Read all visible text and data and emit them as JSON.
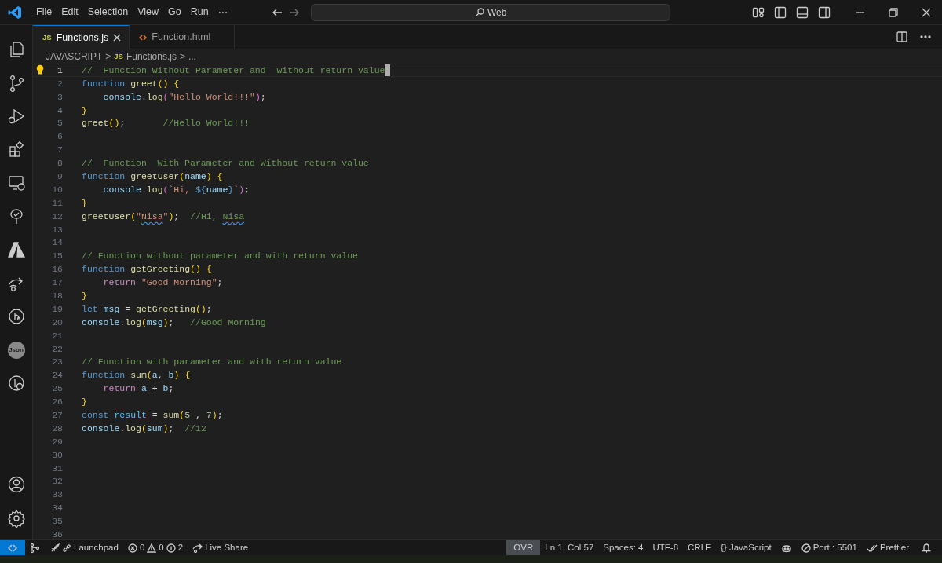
{
  "menu": [
    "File",
    "Edit",
    "Selection",
    "View",
    "Go",
    "Run",
    "···"
  ],
  "search": {
    "value": "Web"
  },
  "activity_bar": {
    "top": [
      {
        "kind": "files"
      },
      {
        "kind": "branch"
      },
      {
        "kind": "debug"
      },
      {
        "kind": "extensions"
      },
      {
        "kind": "remote"
      },
      {
        "kind": "tree"
      },
      {
        "kind": "azure"
      },
      {
        "kind": "share"
      },
      {
        "kind": "gitlens"
      },
      {
        "kind": "json",
        "text": "Json"
      },
      {
        "kind": "inspect"
      }
    ],
    "bottom": [
      {
        "kind": "account"
      },
      {
        "kind": "settings"
      }
    ]
  },
  "tabs": [
    {
      "icon_text": "JS",
      "kind": "js",
      "label": "Functions.js",
      "selected": true
    },
    {
      "kind": "html",
      "label": "Function.html",
      "selected": false
    }
  ],
  "breadcrumb": {
    "folder": "JAVASCRIPT",
    "sep": ">",
    "icon_text": "JS",
    "file": "Functions.js",
    "more": "..."
  },
  "lines": [
    {
      "number": "1",
      "current": true,
      "tokens": [
        {
          "kind": "comment",
          "text": "//  Function Without Parameter and  without return value"
        }
      ]
    },
    {
      "number": "2",
      "current": false,
      "tokens": [
        {
          "kind": "keyword",
          "text": "function "
        },
        {
          "kind": "func",
          "text": "greet"
        },
        {
          "kind": "bracket",
          "text": "() {"
        }
      ]
    },
    {
      "number": "3",
      "current": false,
      "tokens": [
        {
          "kind": "var",
          "text": "    console"
        },
        {
          "kind": "plain",
          "text": "."
        },
        {
          "kind": "func",
          "text": "log"
        },
        {
          "kind": "bracket2",
          "text": "("
        },
        {
          "kind": "string",
          "text": "\"Hello World!!!\""
        },
        {
          "kind": "bracket2",
          "text": ")"
        },
        {
          "kind": "plain",
          "text": ";"
        }
      ]
    },
    {
      "number": "4",
      "current": false,
      "tokens": [
        {
          "kind": "bracket",
          "text": "}"
        }
      ]
    },
    {
      "number": "5",
      "current": false,
      "tokens": [
        {
          "kind": "func",
          "text": "greet"
        },
        {
          "kind": "bracket",
          "text": "()"
        },
        {
          "kind": "plain",
          "text": ";       "
        },
        {
          "kind": "comment",
          "text": "//Hello World!!!"
        }
      ]
    },
    {
      "number": "6",
      "current": false
    },
    {
      "number": "7",
      "current": false
    },
    {
      "number": "8",
      "current": false,
      "tokens": [
        {
          "kind": "comment",
          "text": "//  Function  With Parameter and Without return value"
        }
      ]
    },
    {
      "number": "9",
      "current": false,
      "tokens": [
        {
          "kind": "keyword",
          "text": "function "
        },
        {
          "kind": "func",
          "text": "greetUser"
        },
        {
          "kind": "bracket",
          "text": "("
        },
        {
          "kind": "var",
          "text": "name"
        },
        {
          "kind": "bracket",
          "text": ") {"
        }
      ]
    },
    {
      "number": "10",
      "current": false,
      "tokens": [
        {
          "kind": "var",
          "text": "    console"
        },
        {
          "kind": "plain",
          "text": "."
        },
        {
          "kind": "func",
          "text": "log"
        },
        {
          "kind": "bracket2",
          "text": "("
        },
        {
          "kind": "string",
          "text": "`Hi, "
        },
        {
          "kind": "keyword",
          "text": "${"
        },
        {
          "kind": "var",
          "text": "name"
        },
        {
          "kind": "keyword",
          "text": "}"
        },
        {
          "kind": "string",
          "text": "`"
        },
        {
          "kind": "bracket2",
          "text": ")"
        },
        {
          "kind": "plain",
          "text": ";"
        }
      ]
    },
    {
      "number": "11",
      "current": false,
      "tokens": [
        {
          "kind": "bracket",
          "text": "}"
        }
      ]
    },
    {
      "number": "12",
      "current": false,
      "tokens": [
        {
          "kind": "func",
          "text": "greetUser"
        },
        {
          "kind": "bracket",
          "text": "("
        },
        {
          "kind": "string",
          "text": "\""
        },
        {
          "kind": "string",
          "text": "Nisa",
          "squiggle": true
        },
        {
          "kind": "string",
          "text": "\""
        },
        {
          "kind": "bracket",
          "text": ")"
        },
        {
          "kind": "plain",
          "text": ";  "
        },
        {
          "kind": "comment",
          "text": "//Hi, "
        },
        {
          "kind": "comment",
          "text": "Nisa",
          "squiggle": true
        }
      ]
    },
    {
      "number": "13",
      "current": false
    },
    {
      "number": "14",
      "current": false
    },
    {
      "number": "15",
      "current": false,
      "tokens": [
        {
          "kind": "comment",
          "text": "// Function without parameter and with return value"
        }
      ]
    },
    {
      "number": "16",
      "current": false,
      "tokens": [
        {
          "kind": "keyword",
          "text": "function "
        },
        {
          "kind": "func",
          "text": "getGreeting"
        },
        {
          "kind": "bracket",
          "text": "() {"
        }
      ]
    },
    {
      "number": "17",
      "current": false,
      "tokens": [
        {
          "kind": "control",
          "text": "    return "
        },
        {
          "kind": "string",
          "text": "\"Good Morning\""
        },
        {
          "kind": "plain",
          "text": ";"
        }
      ]
    },
    {
      "number": "18",
      "current": false,
      "tokens": [
        {
          "kind": "bracket",
          "text": "}"
        }
      ]
    },
    {
      "number": "19",
      "current": false,
      "tokens": [
        {
          "kind": "keyword",
          "text": "let "
        },
        {
          "kind": "var",
          "text": "msg"
        },
        {
          "kind": "plain",
          "text": " = "
        },
        {
          "kind": "func",
          "text": "getGreeting"
        },
        {
          "kind": "bracket",
          "text": "()"
        },
        {
          "kind": "plain",
          "text": ";"
        }
      ]
    },
    {
      "number": "20",
      "current": false,
      "tokens": [
        {
          "kind": "var",
          "text": "console"
        },
        {
          "kind": "plain",
          "text": "."
        },
        {
          "kind": "func",
          "text": "log"
        },
        {
          "kind": "bracket",
          "text": "("
        },
        {
          "kind": "var",
          "text": "msg"
        },
        {
          "kind": "bracket",
          "text": ")"
        },
        {
          "kind": "plain",
          "text": ";   "
        },
        {
          "kind": "comment",
          "text": "//Good Morning"
        }
      ]
    },
    {
      "number": "21",
      "current": false
    },
    {
      "number": "22",
      "current": false
    },
    {
      "number": "23",
      "current": false,
      "tokens": [
        {
          "kind": "comment",
          "text": "// Function with parameter and with return value"
        }
      ]
    },
    {
      "number": "24",
      "current": false,
      "tokens": [
        {
          "kind": "keyword",
          "text": "function "
        },
        {
          "kind": "func",
          "text": "sum"
        },
        {
          "kind": "bracket",
          "text": "("
        },
        {
          "kind": "var",
          "text": "a"
        },
        {
          "kind": "plain",
          "text": ", "
        },
        {
          "kind": "var",
          "text": "b"
        },
        {
          "kind": "bracket",
          "text": ") {"
        }
      ]
    },
    {
      "number": "25",
      "current": false,
      "tokens": [
        {
          "kind": "control",
          "text": "    return "
        },
        {
          "kind": "var",
          "text": "a"
        },
        {
          "kind": "plain",
          "text": " + "
        },
        {
          "kind": "var",
          "text": "b"
        },
        {
          "kind": "plain",
          "text": ";"
        }
      ]
    },
    {
      "number": "26",
      "current": false,
      "tokens": [
        {
          "kind": "bracket",
          "text": "}"
        }
      ]
    },
    {
      "number": "27",
      "current": false,
      "tokens": [
        {
          "kind": "keyword",
          "text": "const "
        },
        {
          "kind": "const",
          "text": "result"
        },
        {
          "kind": "plain",
          "text": " = "
        },
        {
          "kind": "func",
          "text": "sum"
        },
        {
          "kind": "bracket",
          "text": "("
        },
        {
          "kind": "number",
          "text": "5"
        },
        {
          "kind": "plain",
          "text": " , "
        },
        {
          "kind": "number",
          "text": "7"
        },
        {
          "kind": "bracket",
          "text": ")"
        },
        {
          "kind": "plain",
          "text": ";"
        }
      ]
    },
    {
      "number": "28",
      "current": false,
      "tokens": [
        {
          "kind": "var",
          "text": "console"
        },
        {
          "kind": "plain",
          "text": "."
        },
        {
          "kind": "func",
          "text": "log"
        },
        {
          "kind": "bracket",
          "text": "("
        },
        {
          "kind": "var",
          "text": "sum"
        },
        {
          "kind": "bracket",
          "text": ")"
        },
        {
          "kind": "plain",
          "text": ";  "
        },
        {
          "kind": "comment",
          "text": "//12"
        }
      ]
    },
    {
      "number": "29",
      "current": false
    },
    {
      "number": "30",
      "current": false
    },
    {
      "number": "31",
      "current": false
    },
    {
      "number": "32",
      "current": false
    },
    {
      "number": "33",
      "current": false
    },
    {
      "number": "34",
      "current": false
    },
    {
      "number": "35",
      "current": false
    },
    {
      "number": "36",
      "current": false
    }
  ],
  "status_bar": {
    "left": [
      {
        "kind": "remote"
      },
      {
        "kind": "graph"
      },
      {
        "kind": "launchpad",
        "label": "Launchpad"
      },
      {
        "kind": "problems",
        "errors": "0",
        "warnings": "0",
        "infos": "2"
      },
      {
        "kind": "liveshare",
        "label": "Live Share"
      }
    ],
    "right": [
      {
        "kind": "mode",
        "label": "OVR"
      },
      {
        "kind": "text",
        "label": "Ln 1, Col 57"
      },
      {
        "kind": "text",
        "label": "Spaces: 4"
      },
      {
        "kind": "text",
        "label": "UTF-8"
      },
      {
        "kind": "text",
        "label": "CRLF"
      },
      {
        "kind": "language",
        "glyph": "{}",
        "label": "JavaScript"
      },
      {
        "kind": "copilot"
      },
      {
        "kind": "port",
        "label": "Port : 5501"
      },
      {
        "kind": "prettier",
        "label": "Prettier"
      },
      {
        "kind": "bell"
      }
    ]
  }
}
